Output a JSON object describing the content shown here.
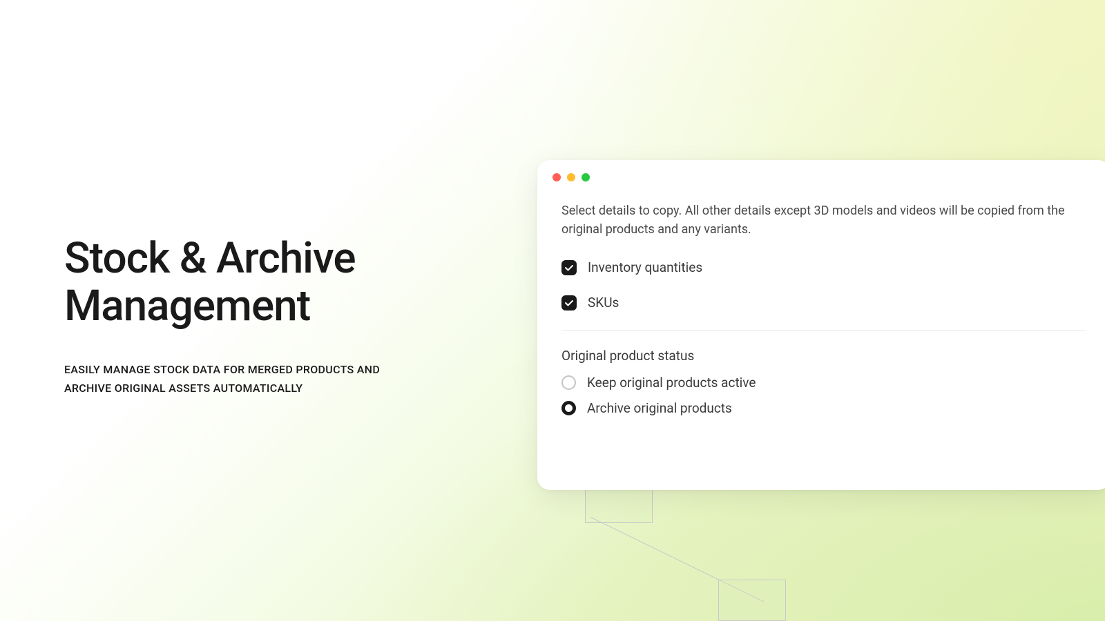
{
  "left": {
    "title_line1": "Stock & Archive",
    "title_line2": "Management",
    "subtitle_line1": "EASILY MANAGE STOCK DATA FOR MERGED PRODUCTS AND",
    "subtitle_line2": "ARCHIVE ORIGINAL ASSETS AUTOMATICALLY"
  },
  "window": {
    "description": "Select details to copy. All other details except 3D models and videos will be copied from the original products and any variants.",
    "checkboxes": [
      {
        "label": "Inventory quantities",
        "checked": true
      },
      {
        "label": "SKUs",
        "checked": true
      }
    ],
    "status_section": {
      "label": "Original product status",
      "options": [
        {
          "label": "Keep original products active",
          "selected": false
        },
        {
          "label": "Archive original products",
          "selected": true
        }
      ]
    }
  }
}
